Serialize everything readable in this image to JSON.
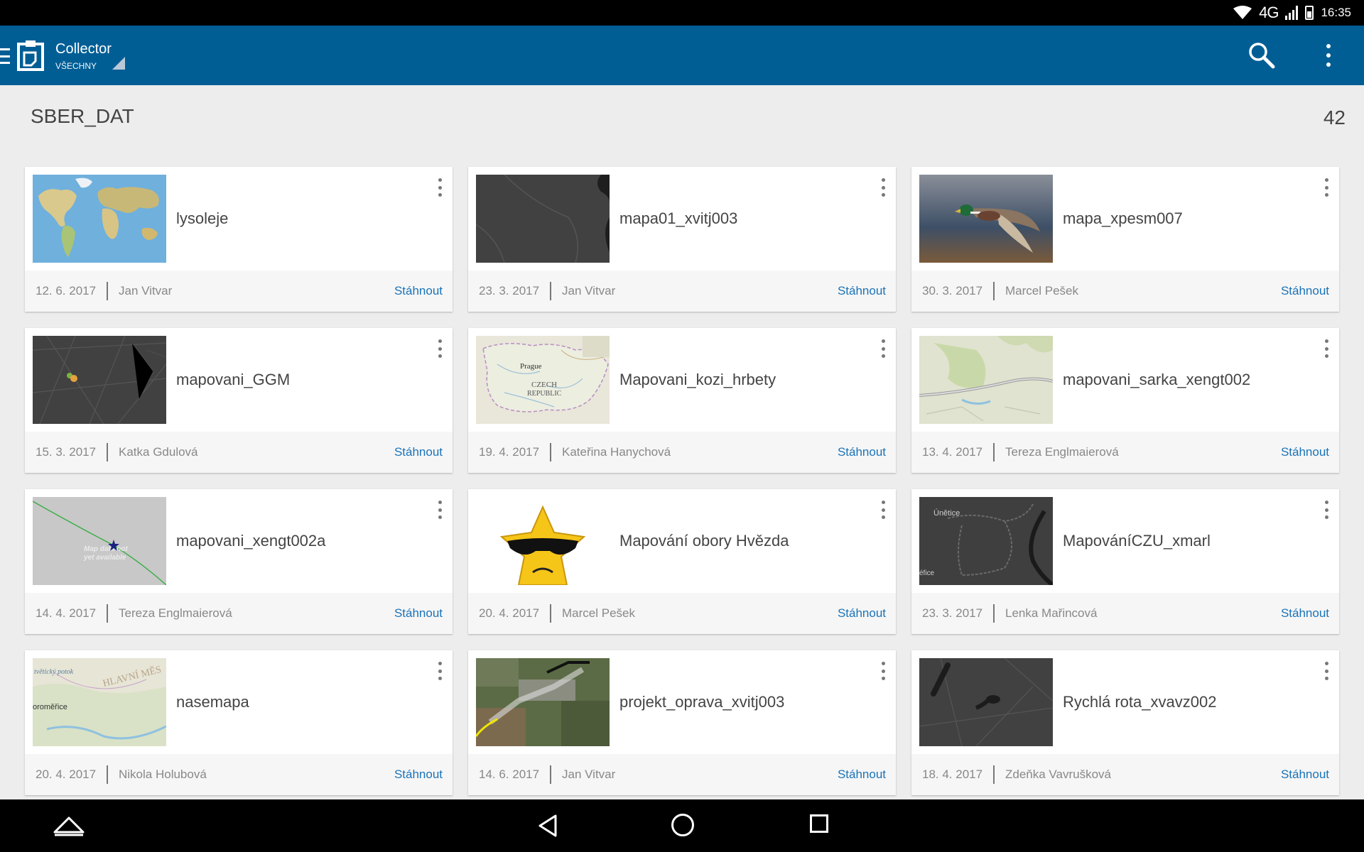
{
  "status_bar": {
    "network": "4G",
    "time": "16:35"
  },
  "app_bar": {
    "title": "Collector",
    "subtitle": "VŠECHNY"
  },
  "section": {
    "title": "SBER_DAT",
    "count": "42"
  },
  "cards": [
    {
      "title": "lysoleje",
      "date": "12. 6. 2017",
      "owner": "Jan Vitvar",
      "action": "Stáhnout"
    },
    {
      "title": "mapa01_xvitj003",
      "date": "23. 3. 2017",
      "owner": "Jan Vitvar",
      "action": "Stáhnout"
    },
    {
      "title": "mapa_xpesm007",
      "date": "30. 3. 2017",
      "owner": "Marcel Pešek",
      "action": "Stáhnout"
    },
    {
      "title": "mapovani_GGM",
      "date": "15. 3. 2017",
      "owner": "Katka Gdulová",
      "action": "Stáhnout"
    },
    {
      "title": "Mapovani_kozi_hrbety",
      "date": "19. 4. 2017",
      "owner": "Kateřina Hanychová",
      "action": "Stáhnout"
    },
    {
      "title": "mapovani_sarka_xengt002",
      "date": "13. 4. 2017",
      "owner": "Tereza Englmaierová",
      "action": "Stáhnout"
    },
    {
      "title": "mapovani_xengt002a",
      "date": "14. 4. 2017",
      "owner": "Tereza Englmaierová",
      "action": "Stáhnout"
    },
    {
      "title": "Mapování obory Hvězda",
      "date": "20. 4. 2017",
      "owner": "Marcel Pešek",
      "action": "Stáhnout"
    },
    {
      "title": "MapováníCZU_xmarl",
      "date": "23. 3. 2017",
      "owner": "Lenka Mařincová",
      "action": "Stáhnout"
    },
    {
      "title": "nasemapa",
      "date": "20. 4. 2017",
      "owner": "Nikola Holubová",
      "action": "Stáhnout"
    },
    {
      "title": "projekt_oprava_xvitj003",
      "date": "14. 6. 2017",
      "owner": "Jan Vitvar",
      "action": "Stáhnout"
    },
    {
      "title": "Rychlá rota_xvavz002",
      "date": "18. 4. 2017",
      "owner": "Zdeňka Vavrušková",
      "action": "Stáhnout"
    }
  ],
  "thumb_labels": {
    "prague": "Prague",
    "czech": "CZECH",
    "republic": "REPUBLIC",
    "map_na_1": "Map data not",
    "map_na_2": "yet available",
    "unetice": "Únětice",
    "efice": "éfice",
    "obromerice": "oroměřice",
    "hlavni": "HLAVNÍ MĚS",
    "potok": "tvětický potok"
  }
}
